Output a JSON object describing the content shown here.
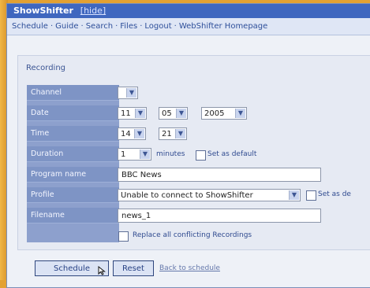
{
  "window": {
    "title": "ShowShifter",
    "title_link": "[hide]"
  },
  "nav": {
    "items": [
      "Schedule",
      "Guide",
      "Search",
      "Files",
      "Logout",
      "WebShifter Homepage"
    ]
  },
  "panel": {
    "title": "Recording"
  },
  "form": {
    "channel_label": "Channel",
    "channel_value": "",
    "date_label": "Date",
    "date_day": "11",
    "date_month": "05",
    "date_year": "2005",
    "time_label": "Time",
    "time_hour": "14",
    "time_minute": "21",
    "duration_label": "Duration",
    "duration_value": "1",
    "duration_unit": "minutes",
    "set_as_default": "Set as default",
    "program_name_label": "Program name",
    "program_name_value": "BBC News",
    "profile_label": "Profile",
    "profile_value": "Unable to connect to ShowShifter",
    "profile_set_as_default": "Set as de",
    "filename_label": "Filename",
    "filename_value": "news_1",
    "replace_conflicting": "Replace all conflicting Recordings"
  },
  "actions": {
    "schedule": "Schedule",
    "reset": "Reset",
    "back_link": "Back to schedule"
  },
  "colors": {
    "background": "#e3a132",
    "accent": "#3f67bf"
  }
}
